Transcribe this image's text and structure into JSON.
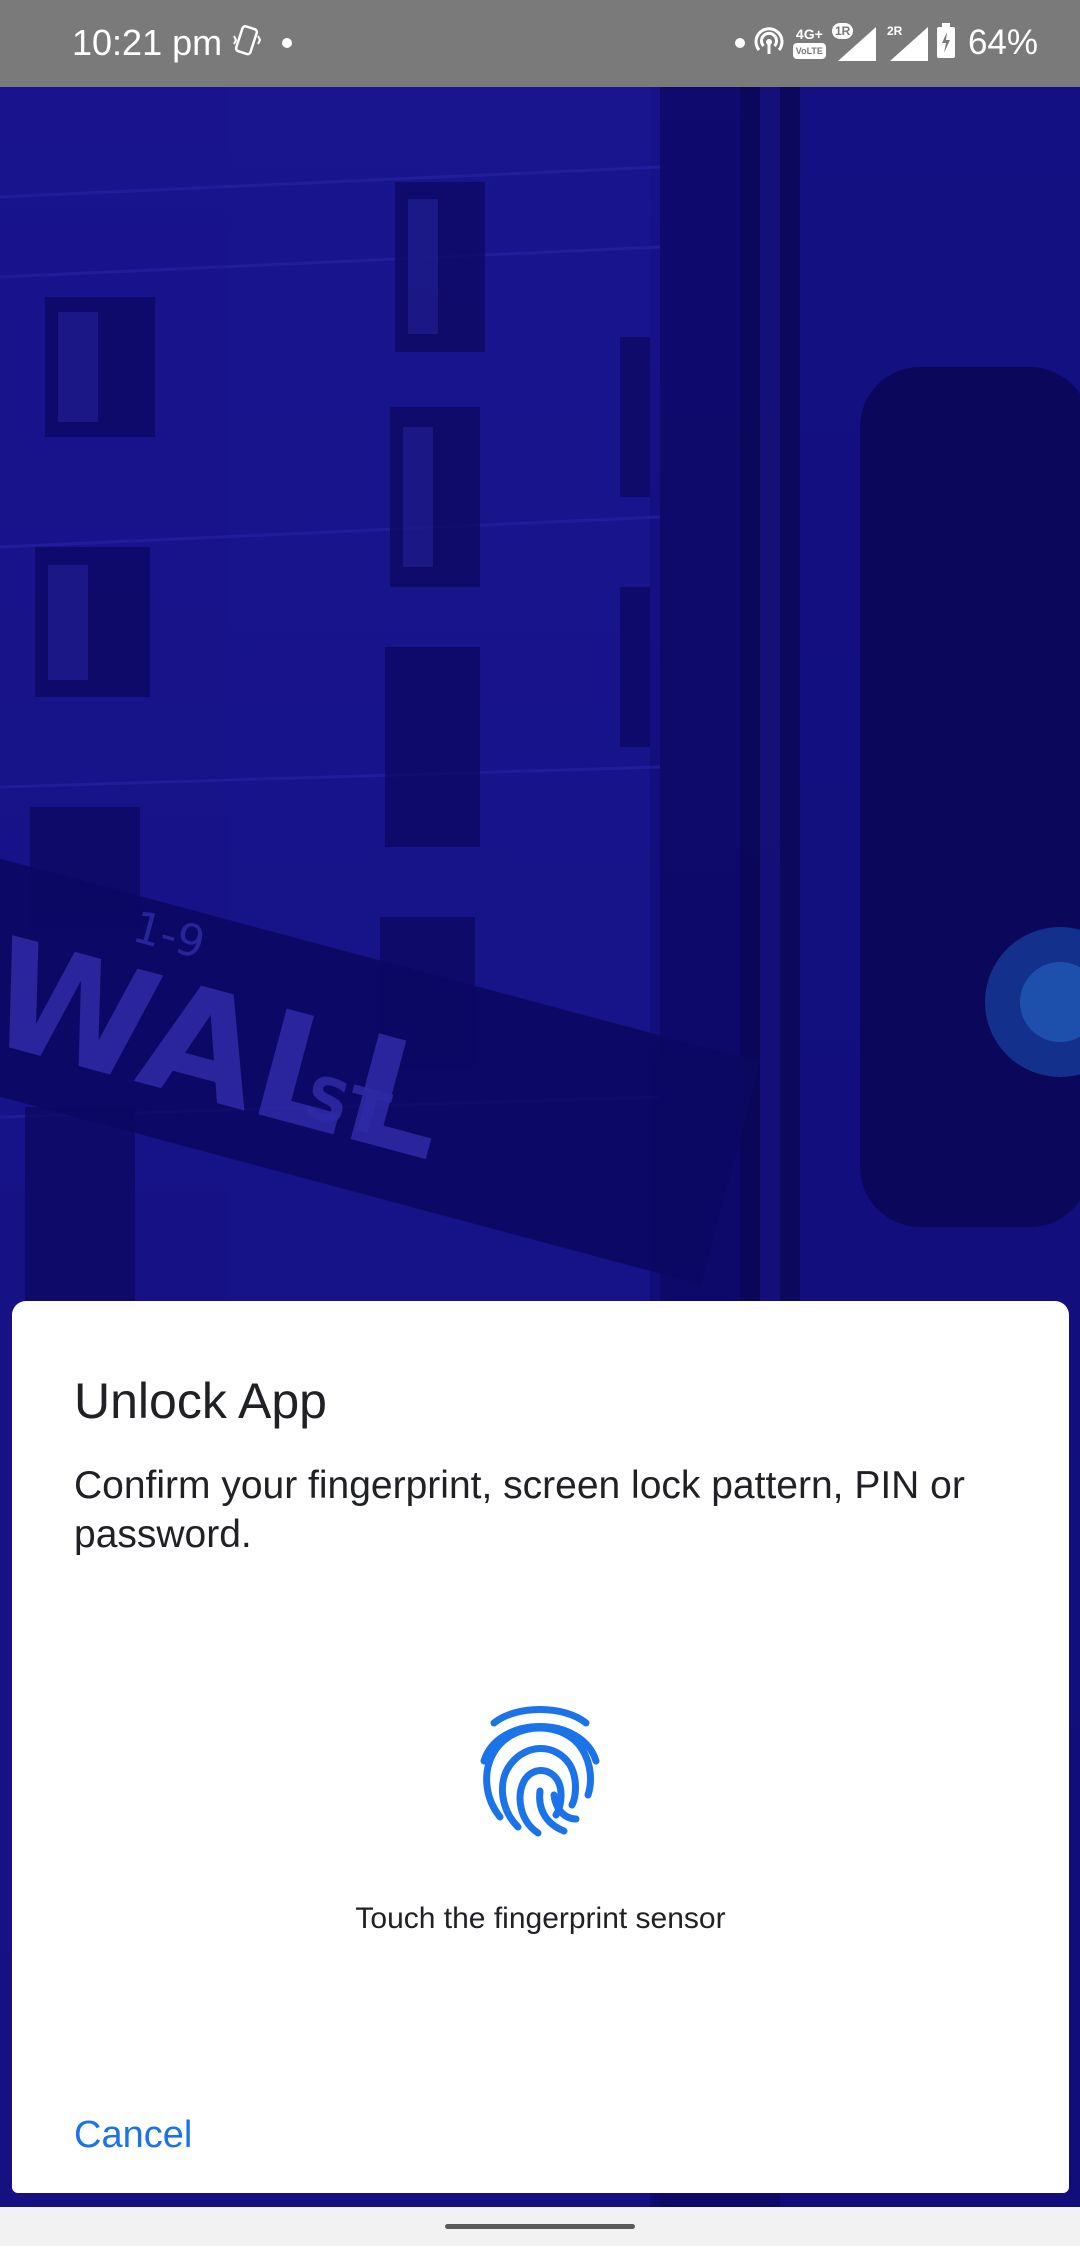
{
  "status_bar": {
    "time": "10:21 pm",
    "network_type": "4G+",
    "network_sub": "VoLTE",
    "sim1_label": "1R",
    "sim2_label": "2R",
    "battery_percent": "64%",
    "icons": [
      "phone-vibrate-icon",
      "notification-dot-icon",
      "hotspot-icon",
      "signal-icon",
      "battery-charging-icon"
    ]
  },
  "background": {
    "sign_text": "WALL",
    "sign_text_2": "ST",
    "sign_small": "1-9",
    "tint_color": "#12108a"
  },
  "dialog": {
    "title": "Unlock App",
    "description": "Confirm your fingerprint, screen lock pattern, PIN or password.",
    "icon": "fingerprint-icon",
    "sensor_hint": "Touch the fingerprint sensor",
    "cancel_label": "Cancel",
    "accent_color": "#1a73e8"
  }
}
